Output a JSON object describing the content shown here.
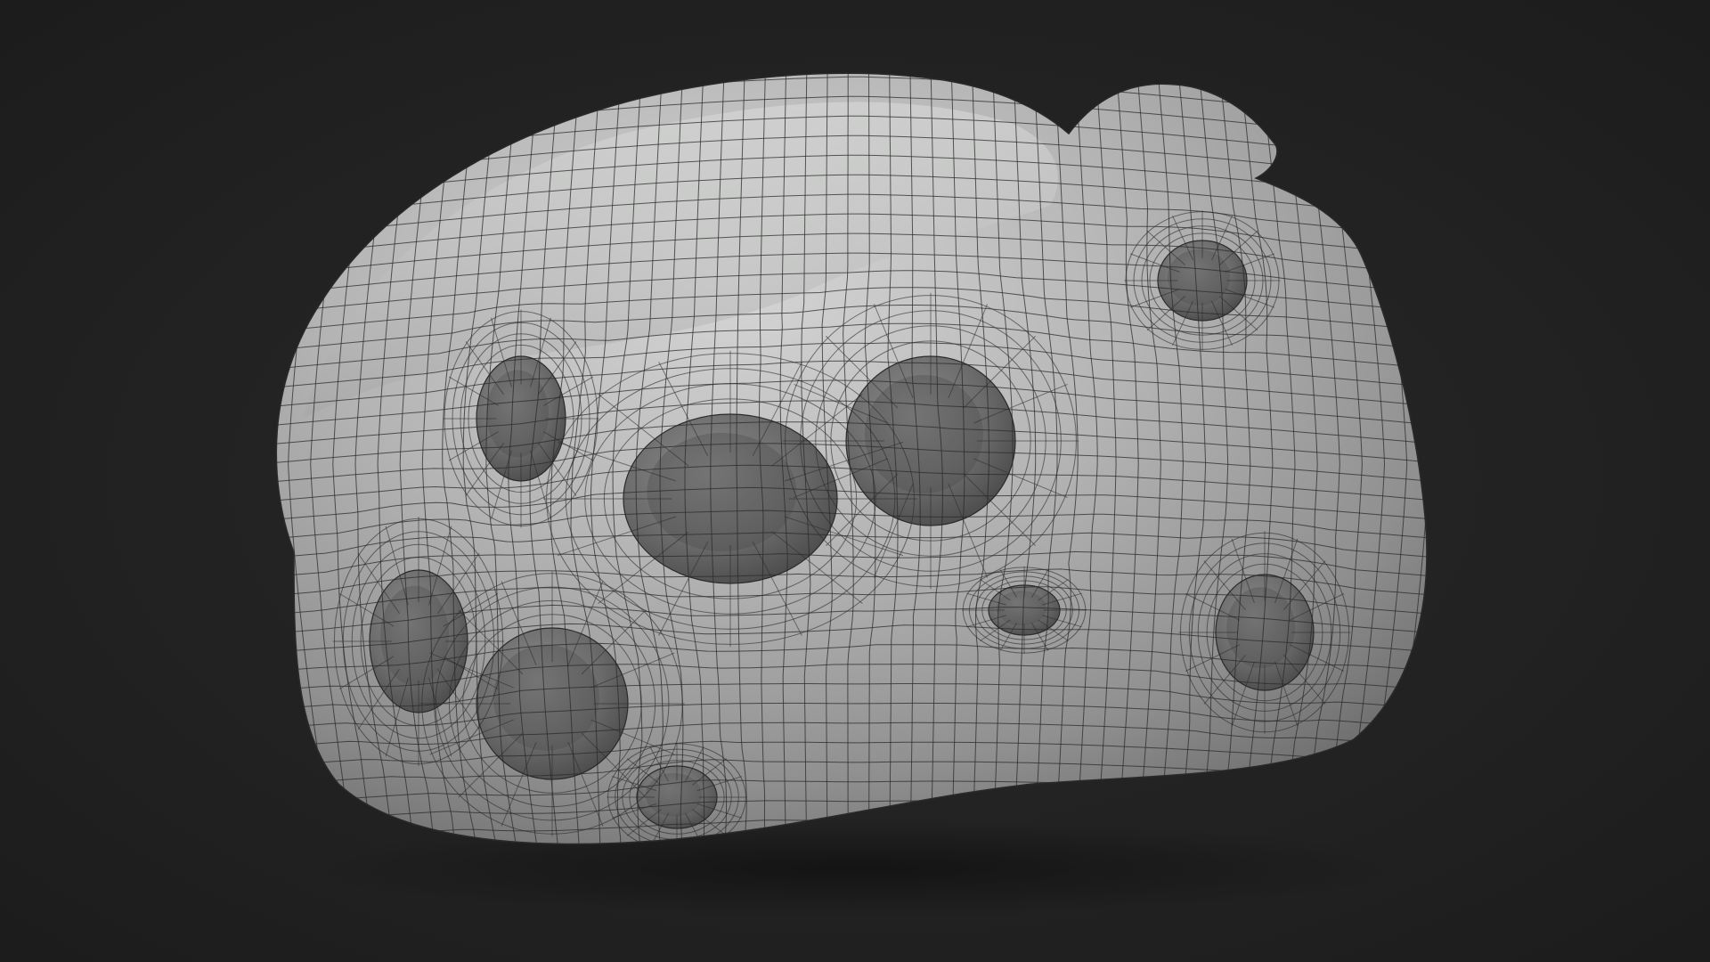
{
  "scene": {
    "subject": "mesh-wireframe-render",
    "colors": {
      "background": "#242424",
      "background_vignette": "#1b1b1b",
      "surface_base": "#a9aaa9",
      "surface_light": "#d4d5d4",
      "surface_shadow": "#6e6f6e",
      "hole_shadow": "#4a4b4a",
      "wire": "#2a2a2a",
      "floor_shadow": "#141414"
    }
  }
}
